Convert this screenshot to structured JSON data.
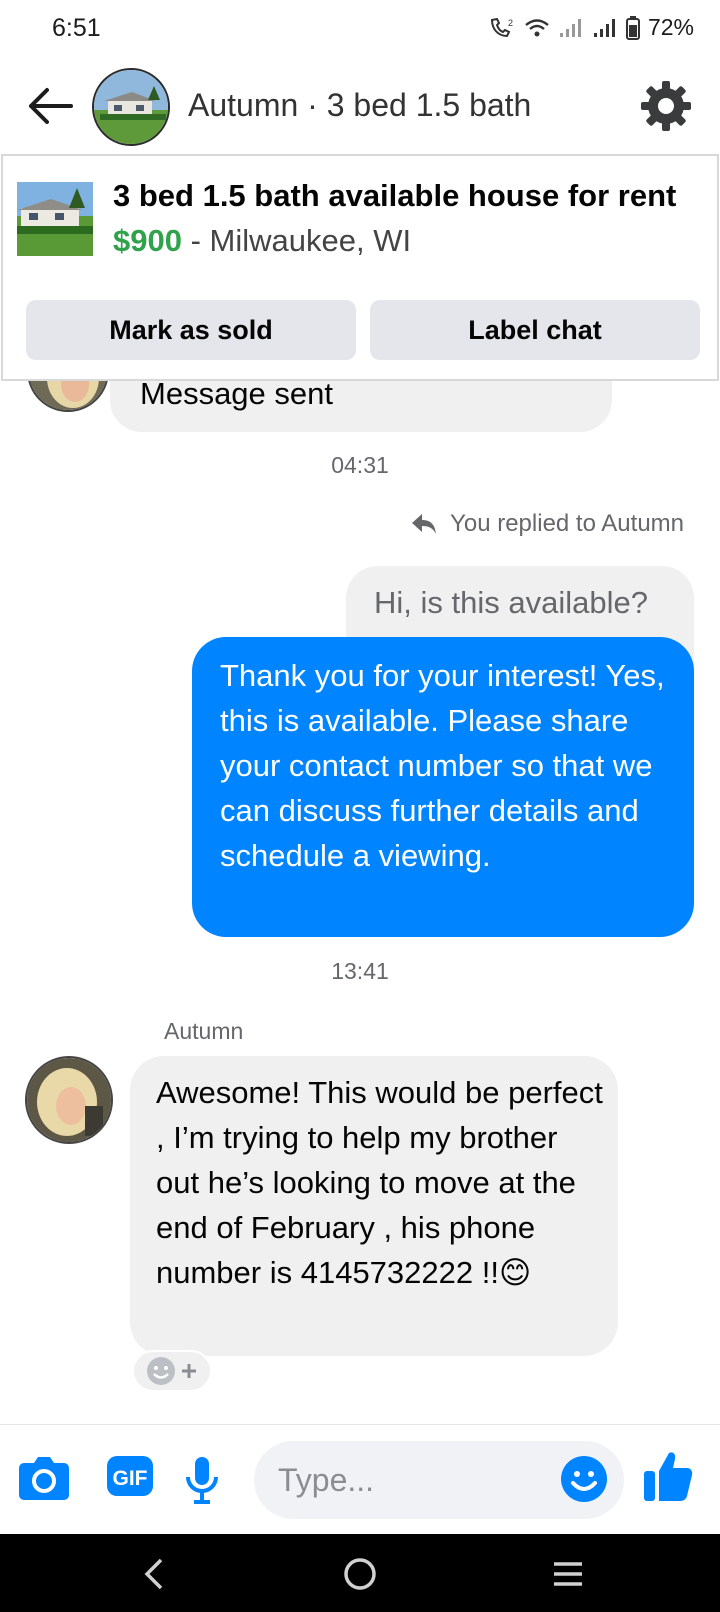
{
  "status_bar": {
    "time": "6:51",
    "battery": "72%"
  },
  "header": {
    "title": "Autumn · 3 bed 1.5 bath"
  },
  "listing": {
    "title": "3 bed 1.5 bath available house for rent",
    "price": "$900",
    "location": " - Milwaukee, WI",
    "mark_sold_label": "Mark as sold",
    "label_chat_label": "Label chat"
  },
  "messages": {
    "message_sent": "Message sent",
    "time_1": "04:31",
    "replied_note": "You replied to Autumn",
    "quoted": "Hi, is this available?",
    "reply": "Thank you for your interest! Yes, this is available. Please share your contact number so that we can discuss further details and schedule a viewing.",
    "time_2": "13:41",
    "sender": "Autumn",
    "incoming": "Awesome! This would be perfect , I’m trying to help my brother out he’s looking to move at the end of February , his phone number is 4145732222 !!",
    "incoming_emoji": "😊"
  },
  "composer": {
    "placeholder": "Type...",
    "gif_label": "GIF"
  },
  "colors": {
    "accent": "#0084ff",
    "price_green": "#31a24c",
    "bubble_gray": "#f0f0f0"
  }
}
